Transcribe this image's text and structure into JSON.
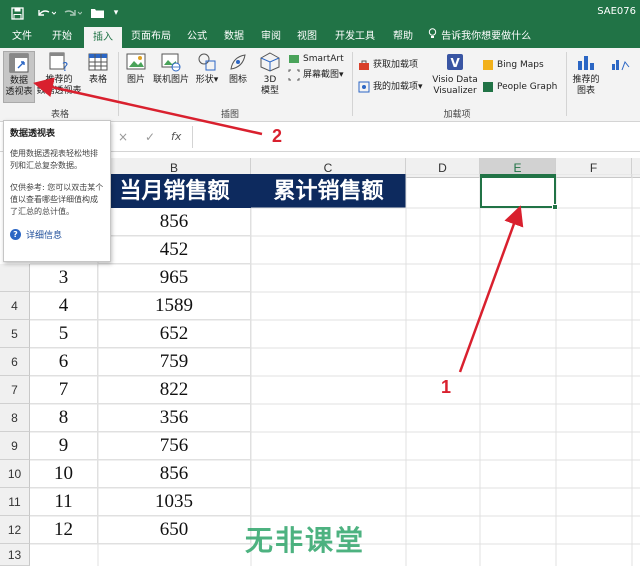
{
  "window": {
    "title": "SAE076"
  },
  "quick_access": {
    "save_icon": "save-icon",
    "undo_icon": "undo-icon",
    "redo_icon": "redo-icon",
    "open_icon": "folder-icon"
  },
  "tabs": [
    "文件",
    "开始",
    "插入",
    "页面布局",
    "公式",
    "数据",
    "审阅",
    "视图",
    "开发工具",
    "帮助"
  ],
  "tell_me": "告诉我你想要做什么",
  "ribbon": {
    "pivot_table": [
      "数据",
      "透视表"
    ],
    "recommended_pivot": [
      "推荐的",
      "数据透视表"
    ],
    "table": "表格",
    "group_tables": "表格",
    "picture": "图片",
    "online_picture": "联机图片",
    "shapes": "形状",
    "icons": "图标",
    "model3d": [
      "3D",
      "模型"
    ],
    "smartart": "SmartArt",
    "screenshot": "屏幕截图",
    "group_illustrations": "插图",
    "get_addins": "获取加载项",
    "my_addins": "我的加载项",
    "visio": [
      "Visio Data",
      "Visualizer"
    ],
    "bing_maps": "Bing Maps",
    "people_graph": "People Graph",
    "group_addins": "加载项",
    "rec_charts": [
      "推荐的",
      "图表"
    ]
  },
  "formula_bar": {
    "cancel": "×",
    "enter": "✓",
    "fx": "fx",
    "value": ""
  },
  "columns": [
    "B",
    "C",
    "D",
    "E",
    "F"
  ],
  "rows": [
    "4",
    "5",
    "6",
    "7",
    "8",
    "9",
    "10",
    "11",
    "12",
    "13"
  ],
  "sheet": {
    "header_b": "当月销售额",
    "header_c": "累计销售额",
    "a_values": [
      "3",
      "4",
      "5",
      "6",
      "7",
      "8",
      "9",
      "10",
      "11",
      "12"
    ],
    "b_values": [
      "856",
      "452",
      "965",
      "1589",
      "652",
      "759",
      "822",
      "356",
      "756",
      "856",
      "1035",
      "650"
    ]
  },
  "tooltip": {
    "title": "数据透视表",
    "desc": "使用数据透视表轻松地排列和汇总复杂数据。",
    "note": "仅供参考: 您可以双击某个值以查看哪些详细值构成了汇总的总计值。",
    "more": "详细信息"
  },
  "annotations": {
    "one": "1",
    "two": "2",
    "color": "#d9202e"
  },
  "watermark": "无非课堂",
  "colors": {
    "excel_green": "#217346",
    "header_fill": "#0d2a5e"
  }
}
